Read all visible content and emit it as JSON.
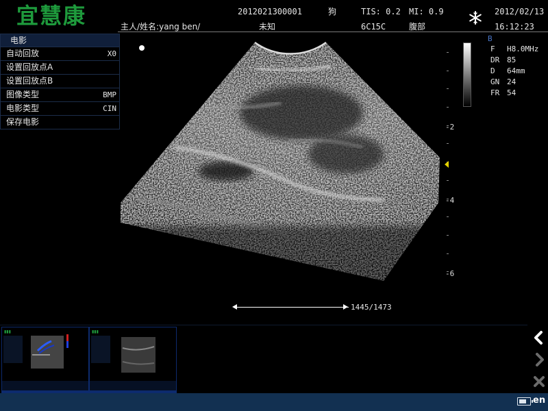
{
  "header": {
    "logo": "宜慧康",
    "patient_id": "2012021300001",
    "species": "狗",
    "tis": "TIS: 0.2",
    "mi": "MI: 0.9",
    "date": "2012/02/13",
    "owner": "主人/姓名:yang ben/",
    "gender": "未知",
    "probe": "6C15C",
    "exam_region": "腹部",
    "time": "16:12:23",
    "freeze_icon": "snowflake-icon"
  },
  "cine_menu": {
    "title": "电影",
    "items": [
      {
        "label": "自动回放",
        "value": "X0"
      },
      {
        "label": "设置回放点A",
        "value": ""
      },
      {
        "label": "设置回放点B",
        "value": ""
      },
      {
        "label": "图像类型",
        "value": "BMP"
      },
      {
        "label": "电影类型",
        "value": "CIN"
      },
      {
        "label": "保存电影",
        "value": ""
      }
    ]
  },
  "params": {
    "mode": "B",
    "rows": [
      {
        "key": "F",
        "value": "H8.0MHz"
      },
      {
        "key": "DR",
        "value": "85"
      },
      {
        "key": "D",
        "value": "64mm"
      },
      {
        "key": "GN",
        "value": "24"
      },
      {
        "key": "FR",
        "value": "54"
      }
    ]
  },
  "depth_scale": {
    "labels": [
      "-2",
      "-4",
      "-6"
    ],
    "focus_marker_color": "#e4d200"
  },
  "cine": {
    "frame_counter": "1445/1473",
    "current_frame": 1445,
    "total_frames": 1473
  },
  "thumbnails": [
    {
      "name": "color-doppler-clip"
    },
    {
      "name": "b-mode-clip"
    }
  ],
  "side_nav": {
    "back_icon": "chevron-left-icon",
    "forward_icon": "chevron-right-icon",
    "close_icon": "close-icon"
  },
  "footer": {
    "battery_icon": "battery-icon",
    "language": "en"
  },
  "colors": {
    "logo": "#1e9a3c",
    "menu_header": "#101f3a",
    "footer": "#123051",
    "thumb_border": "#0d2b6e",
    "mode_label": "#4a76c8"
  }
}
